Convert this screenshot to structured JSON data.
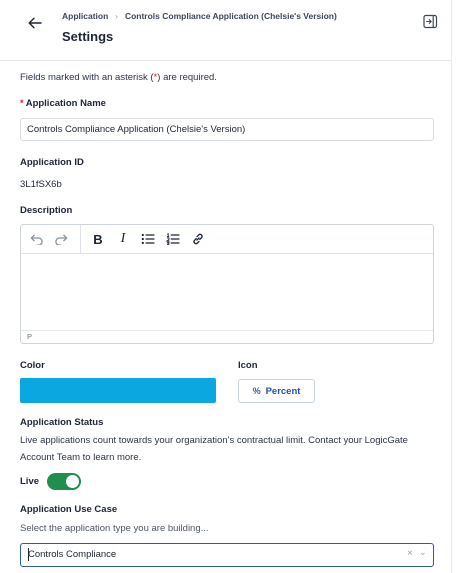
{
  "header": {
    "breadcrumb": [
      "Application",
      "Controls Compliance Application (Chelsie's Version)"
    ],
    "breadcrumb_separator": "›",
    "title": "Settings",
    "back_icon": "arrow-left-icon",
    "collapse_icon": "collapse-panel-icon"
  },
  "form": {
    "required_note_prefix": "Fields marked with an asterisk (",
    "required_note_asterisk": "*",
    "required_note_suffix": ") are required.",
    "application_name": {
      "required_marker": "*",
      "label": "Application Name",
      "value": "Controls Compliance Application (Chelsie's Version)"
    },
    "application_id": {
      "label": "Application ID",
      "value": "3L1fSX6b"
    },
    "description": {
      "label": "Description",
      "toolbar": [
        "undo-icon",
        "redo-icon",
        "bold-icon",
        "italic-icon",
        "bullet-list-icon",
        "numbered-list-icon",
        "link-icon"
      ],
      "bold_glyph": "B",
      "italic_glyph": "I",
      "status_text": "P"
    },
    "color": {
      "label": "Color",
      "value_hex": "#0ba7e0"
    },
    "icon": {
      "label": "Icon",
      "symbol": "%",
      "value": "Percent"
    },
    "status": {
      "label": "Application Status",
      "description": "Live applications count towards your organization’s contractual limit. Contact your LogicGate Account Team to learn more.",
      "toggle_label": "Live",
      "toggle_on": true,
      "toggle_color": "#1e8f4e"
    },
    "use_case": {
      "label": "Application Use Case",
      "helper": "Select the application type you are building...",
      "value": "Controls Compliance",
      "clear_glyph": "×",
      "chevron_glyph": "⌄"
    }
  },
  "colors": {
    "accent": "#2b5ea7",
    "required": "#c5283d",
    "live_green": "#1e8f4e"
  }
}
